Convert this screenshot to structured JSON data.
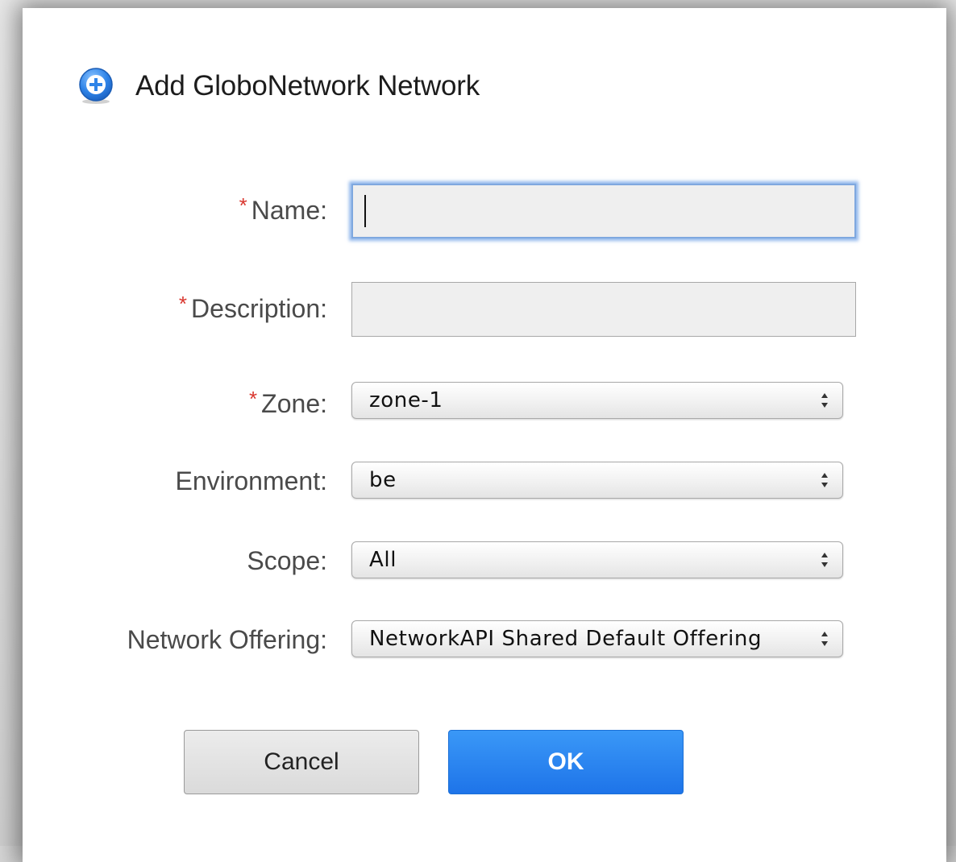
{
  "dialog": {
    "title": "Add GloboNetwork Network",
    "icon": "plus-circle-icon",
    "accent_color": "#2f84e8"
  },
  "form": {
    "required_marker": "*",
    "required_color": "#d9372f",
    "name": {
      "label": "Name:",
      "value": "",
      "required": true
    },
    "description": {
      "label": "Description:",
      "value": "",
      "required": true
    },
    "zone": {
      "label": "Zone:",
      "value": "zone-1",
      "required": true
    },
    "environment": {
      "label": "Environment:",
      "value": "be",
      "required": false
    },
    "scope": {
      "label": "Scope:",
      "value": "All",
      "required": false
    },
    "network_offering": {
      "label": "Network Offering:",
      "value": "NetworkAPI Shared Default Offering",
      "required": false
    }
  },
  "buttons": {
    "cancel_label": "Cancel",
    "ok_label": "OK",
    "ok_color": "#1e74e9"
  }
}
